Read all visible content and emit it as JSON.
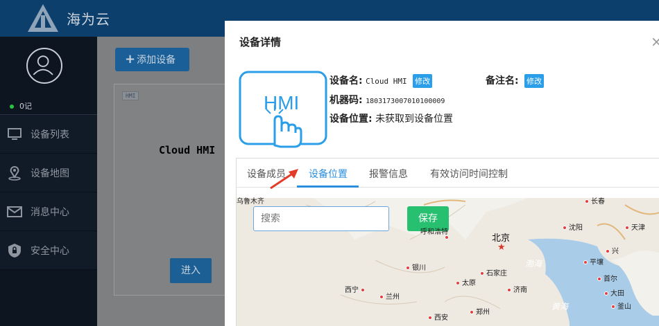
{
  "app": {
    "brand": "海为云"
  },
  "sidebar": {
    "status": "0记",
    "items": [
      {
        "label": "设备列表",
        "icon": "monitor-icon"
      },
      {
        "label": "设备地图",
        "icon": "map-pin-icon"
      },
      {
        "label": "消息中心",
        "icon": "mail-icon"
      },
      {
        "label": "安全中心",
        "icon": "shield-lock-icon"
      }
    ]
  },
  "main": {
    "add_button": "添加设备",
    "card": {
      "tag": "HMI",
      "name": "Cloud HMI",
      "enter_button": "进入"
    }
  },
  "modal": {
    "title": "设备详情",
    "close": "×",
    "icon_text": "HMI",
    "device_name_label": "设备名:",
    "device_name_value": "Cloud HMI",
    "edit_label": "修改",
    "remark_label": "备注名:",
    "machine_code_label": "机器码:",
    "machine_code_value": "1803173007010100009",
    "location_label": "设备位置:",
    "location_value": "未获取到设备位置",
    "tabs": [
      "设备成员",
      "设备位置",
      "报警信息",
      "有效访问时间控制"
    ],
    "active_tab": 1,
    "map": {
      "search_placeholder": "搜索",
      "save_button": "保存",
      "capital": "北京",
      "cities": [
        "乌鲁木齐",
        "长春",
        "沈阳",
        "天津",
        "呼和浩特",
        "兴",
        "平壤",
        "银川",
        "石家庄",
        "太原",
        "首尔",
        "大田",
        "西宁",
        "济南",
        "兰州",
        "釜山",
        "郑州",
        "西安"
      ],
      "seas": [
        "渤海",
        "黄海"
      ]
    }
  },
  "colors": {
    "topbar": "#0c3f6c",
    "sidebar": "#0d1521",
    "accent": "#2a8ee0",
    "save": "#26c070"
  }
}
